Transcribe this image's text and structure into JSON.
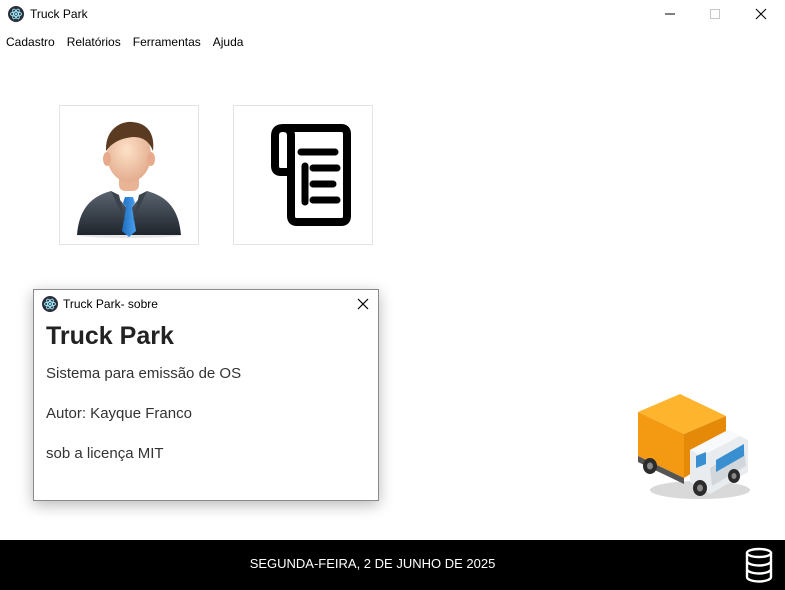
{
  "window": {
    "title": "Truck Park",
    "icon": "electron-icon",
    "controls": [
      "minimize",
      "maximize",
      "close"
    ]
  },
  "menu": {
    "items": [
      "Cadastro",
      "Relatórios",
      "Ferramentas",
      "Ajuda"
    ]
  },
  "tiles": [
    {
      "name": "user-tile",
      "icon": "businessman-avatar-icon"
    },
    {
      "name": "document-tile",
      "icon": "document-scroll-icon"
    }
  ],
  "dialog": {
    "title": "Truck Park- sobre",
    "heading": "Truck Park",
    "line1": "Sistema para emissão de OS",
    "line2": "Autor: Kayque Franco",
    "line3": "sob a licença MIT"
  },
  "status": {
    "date": "SEGUNDA-FEIRA, 2 DE JUNHO DE 2025",
    "icon": "database-icon"
  },
  "colors": {
    "status_bar_bg": "#000000",
    "truck_cargo": "#f7a21b",
    "tie": "#2a7fd4"
  }
}
